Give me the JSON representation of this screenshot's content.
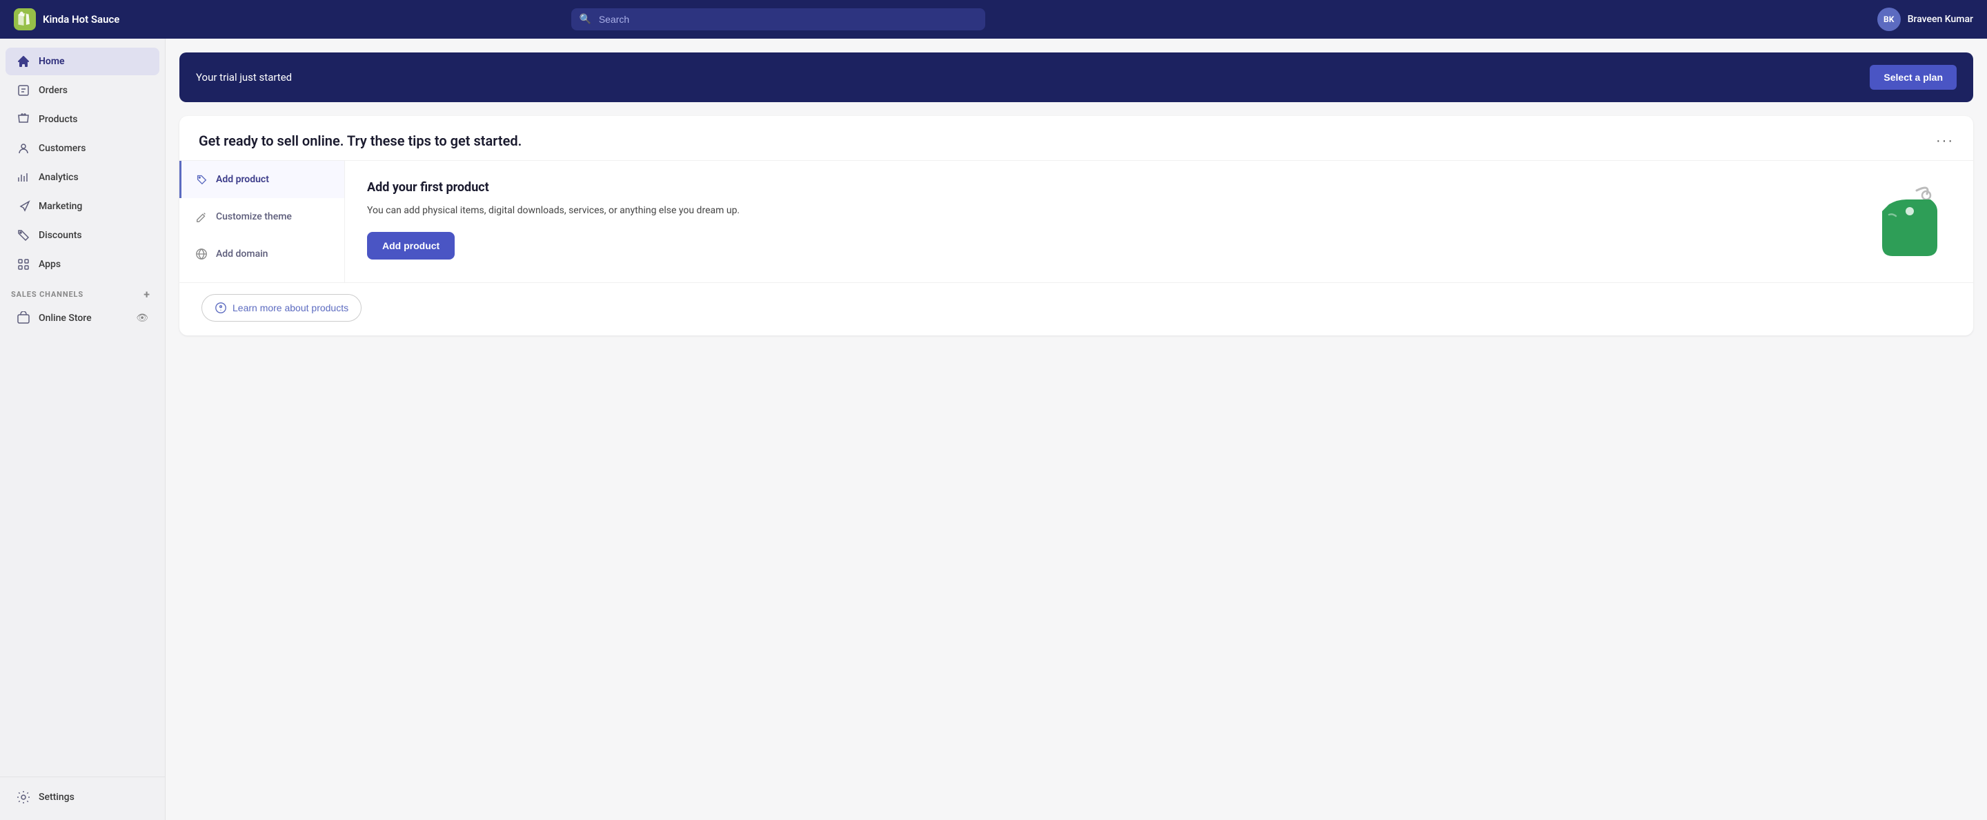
{
  "app": {
    "store_name": "Kinda Hot Sauce",
    "logo_alt": "Shopify logo"
  },
  "topnav": {
    "search_placeholder": "Search",
    "user_initials": "BK",
    "user_name": "Braveen Kumar"
  },
  "sidebar": {
    "items": [
      {
        "id": "home",
        "label": "Home",
        "icon": "home",
        "active": true
      },
      {
        "id": "orders",
        "label": "Orders",
        "icon": "orders",
        "active": false
      },
      {
        "id": "products",
        "label": "Products",
        "icon": "products",
        "active": false
      },
      {
        "id": "customers",
        "label": "Customers",
        "icon": "customers",
        "active": false
      },
      {
        "id": "analytics",
        "label": "Analytics",
        "icon": "analytics",
        "active": false
      },
      {
        "id": "marketing",
        "label": "Marketing",
        "icon": "marketing",
        "active": false
      },
      {
        "id": "discounts",
        "label": "Discounts",
        "icon": "discounts",
        "active": false
      },
      {
        "id": "apps",
        "label": "Apps",
        "icon": "apps",
        "active": false
      }
    ],
    "sales_channels_label": "SALES CHANNELS",
    "online_store_label": "Online Store",
    "settings_label": "Settings"
  },
  "trial_banner": {
    "text": "Your trial just started",
    "button_label": "Select a plan"
  },
  "tips_card": {
    "title": "Get ready to sell online. Try these tips to get started.",
    "menu_items": [
      {
        "id": "add-product",
        "label": "Add product",
        "active": true,
        "icon": "tag"
      },
      {
        "id": "customize-theme",
        "label": "Customize theme",
        "active": false,
        "icon": "paint"
      },
      {
        "id": "add-domain",
        "label": "Add domain",
        "active": false,
        "icon": "globe"
      }
    ],
    "content": {
      "title": "Add your first product",
      "description": "You can add physical items, digital downloads, services, or anything else you dream up.",
      "button_label": "Add product"
    },
    "footer": {
      "learn_more_label": "Learn more about products"
    }
  }
}
